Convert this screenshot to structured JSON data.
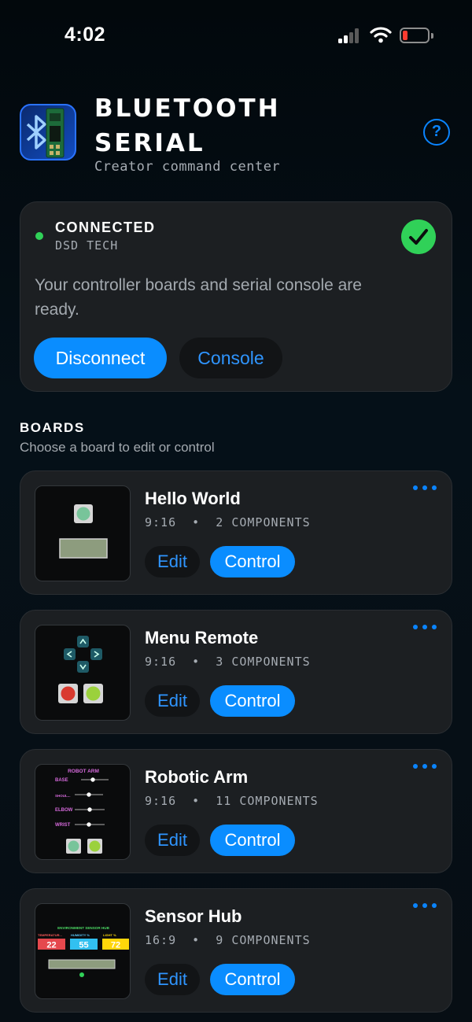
{
  "status_bar": {
    "time": "4:02",
    "icons": [
      "cellular-signal-icon",
      "wifi-icon",
      "battery-low-icon"
    ]
  },
  "header": {
    "app_icon": "bluetooth-board-app-icon",
    "title": "BLUETOOTH SERIAL",
    "subtitle": "Creator command center",
    "help_glyph": "?"
  },
  "connection": {
    "status": "CONNECTED",
    "device": "DSD TECH",
    "description": "Your controller boards and serial console are ready.",
    "disconnect_label": "Disconnect",
    "console_label": "Console",
    "status_color": "#30d158"
  },
  "boards_section": {
    "title": "BOARDS",
    "subtitle": "Choose a board to edit or control"
  },
  "boards": [
    {
      "name": "Hello World",
      "orientation": "9:16",
      "components": "2 COMPONENTS",
      "edit_label": "Edit",
      "control_label": "Control"
    },
    {
      "name": "Menu Remote",
      "orientation": "9:16",
      "components": "3 COMPONENTS",
      "edit_label": "Edit",
      "control_label": "Control"
    },
    {
      "name": "Robotic Arm",
      "orientation": "9:16",
      "components": "11 COMPONENTS",
      "edit_label": "Edit",
      "control_label": "Control",
      "thumb": {
        "title": "ROBOT ARM",
        "sliders": [
          "BASE",
          "SHOUL...",
          "ELBOW",
          "WRIST"
        ]
      }
    },
    {
      "name": "Sensor Hub",
      "orientation": "16:9",
      "components": "9 COMPONENTS",
      "edit_label": "Edit",
      "control_label": "Control",
      "thumb": {
        "title": "ENVIRONMENT SENSOR HUB",
        "labels": [
          "TEMPERATUR...",
          "HUMIDITY %",
          "LIGHT %"
        ],
        "values": [
          "22",
          "55",
          "72"
        ]
      }
    }
  ],
  "colors": {
    "accent": "#0a8dff",
    "card": "#1c1f22",
    "success": "#30d158",
    "battery_low": "#ff3b30"
  }
}
